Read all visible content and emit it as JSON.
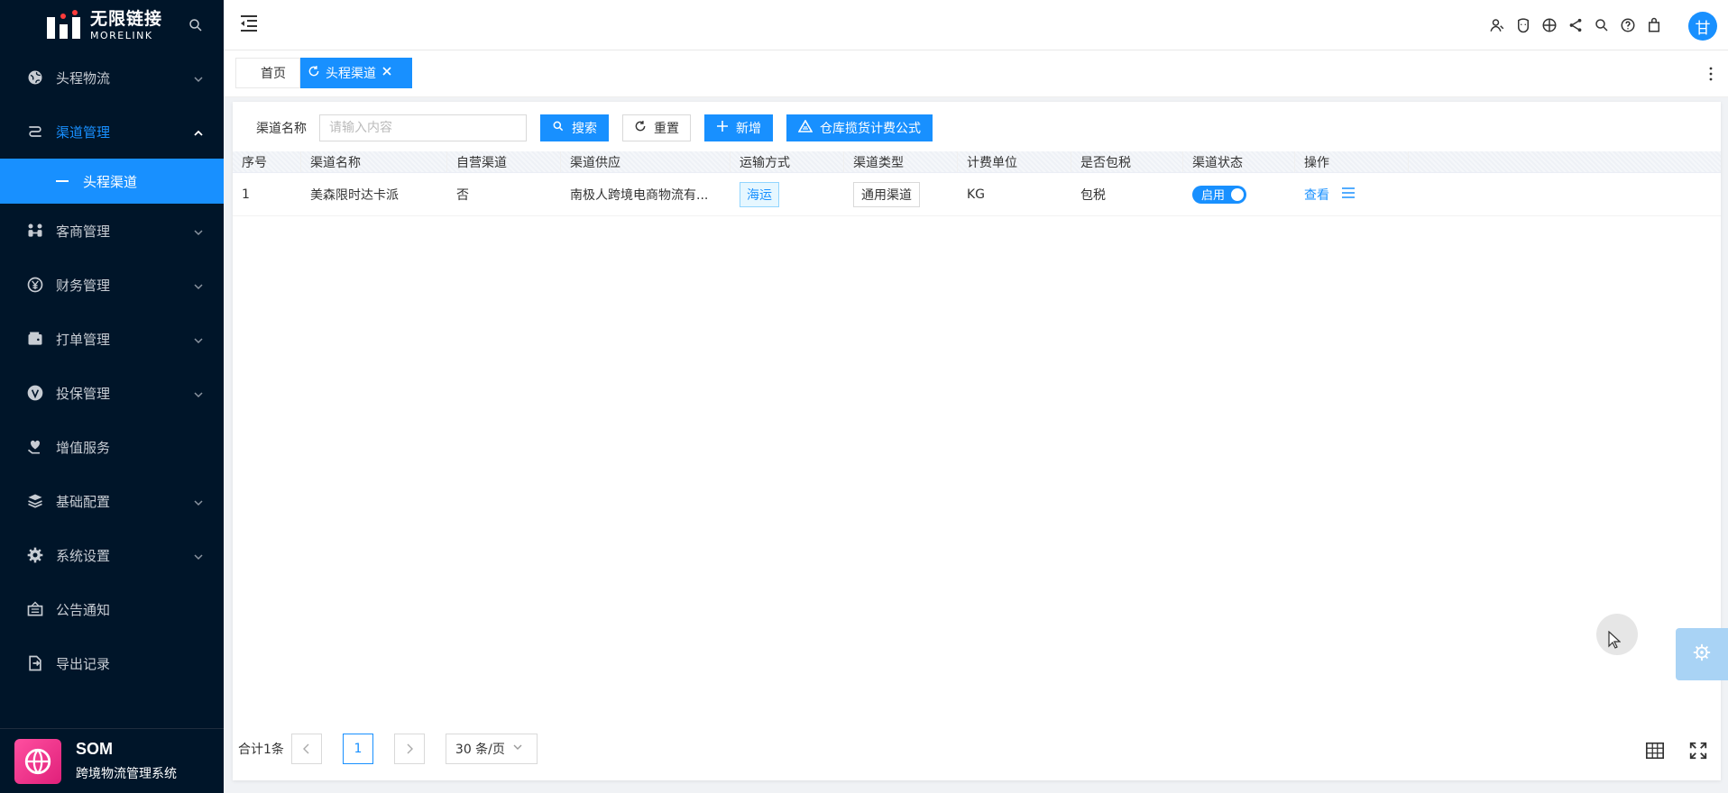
{
  "brand": {
    "logo_cn": "无限链接",
    "logo_en": "MORELINK",
    "product": "SOM",
    "product_sub": "跨境物流管理系统"
  },
  "sidebar": {
    "items": [
      {
        "label": "头程物流",
        "icon": "globe-icon",
        "has_chevron": true
      },
      {
        "label": "渠道管理",
        "icon": "route-icon",
        "has_chevron": true,
        "open": true
      },
      {
        "label": "客商管理",
        "icon": "people-icon",
        "has_chevron": true
      },
      {
        "label": "财务管理",
        "icon": "yuan-icon",
        "has_chevron": true
      },
      {
        "label": "打单管理",
        "icon": "wallet-icon",
        "has_chevron": true
      },
      {
        "label": "投保管理",
        "icon": "shield-icon",
        "has_chevron": true
      },
      {
        "label": "增值服务",
        "icon": "heart-hand-icon",
        "has_chevron": false
      },
      {
        "label": "基础配置",
        "icon": "layers-icon",
        "has_chevron": true
      },
      {
        "label": "系统设置",
        "icon": "gear-icon",
        "has_chevron": true
      },
      {
        "label": "公告通知",
        "icon": "announce-icon",
        "has_chevron": false
      },
      {
        "label": "导出记录",
        "icon": "export-icon",
        "has_chevron": false
      }
    ],
    "active_sub": "头程渠道"
  },
  "header": {
    "icons": [
      "user-icon",
      "emoji-icon",
      "globe-icon",
      "share-icon",
      "search-icon",
      "help-icon",
      "bag-icon"
    ],
    "avatar_text": "甘"
  },
  "tabs": {
    "home": "首页",
    "active": "头程渠道"
  },
  "search": {
    "label": "渠道名称",
    "placeholder": "请输入内容",
    "search_btn": "搜索",
    "reset_btn": "重置",
    "add_btn": "新增",
    "formula_btn": "仓库揽货计费公式"
  },
  "table": {
    "headers": [
      "序号",
      "渠道名称",
      "自营渠道",
      "渠道供应",
      "运输方式",
      "渠道类型",
      "计费单位",
      "是否包税",
      "渠道状态",
      "操作"
    ],
    "rows": [
      {
        "index": "1",
        "name": "美森限时达卡派",
        "self_run": "否",
        "supplier": "南极人跨境电商物流有...",
        "transport": "海运",
        "channel_type": "通用渠道",
        "unit": "KG",
        "tax_included": "包税",
        "status": "启用",
        "action_view": "查看"
      }
    ]
  },
  "pagination": {
    "total": "合计1条",
    "current": "1",
    "page_size": "30 条/页"
  },
  "colors": {
    "primary": "#1890ff",
    "sidebar_bg": "#001529",
    "brand_pink": "#e0207a"
  }
}
